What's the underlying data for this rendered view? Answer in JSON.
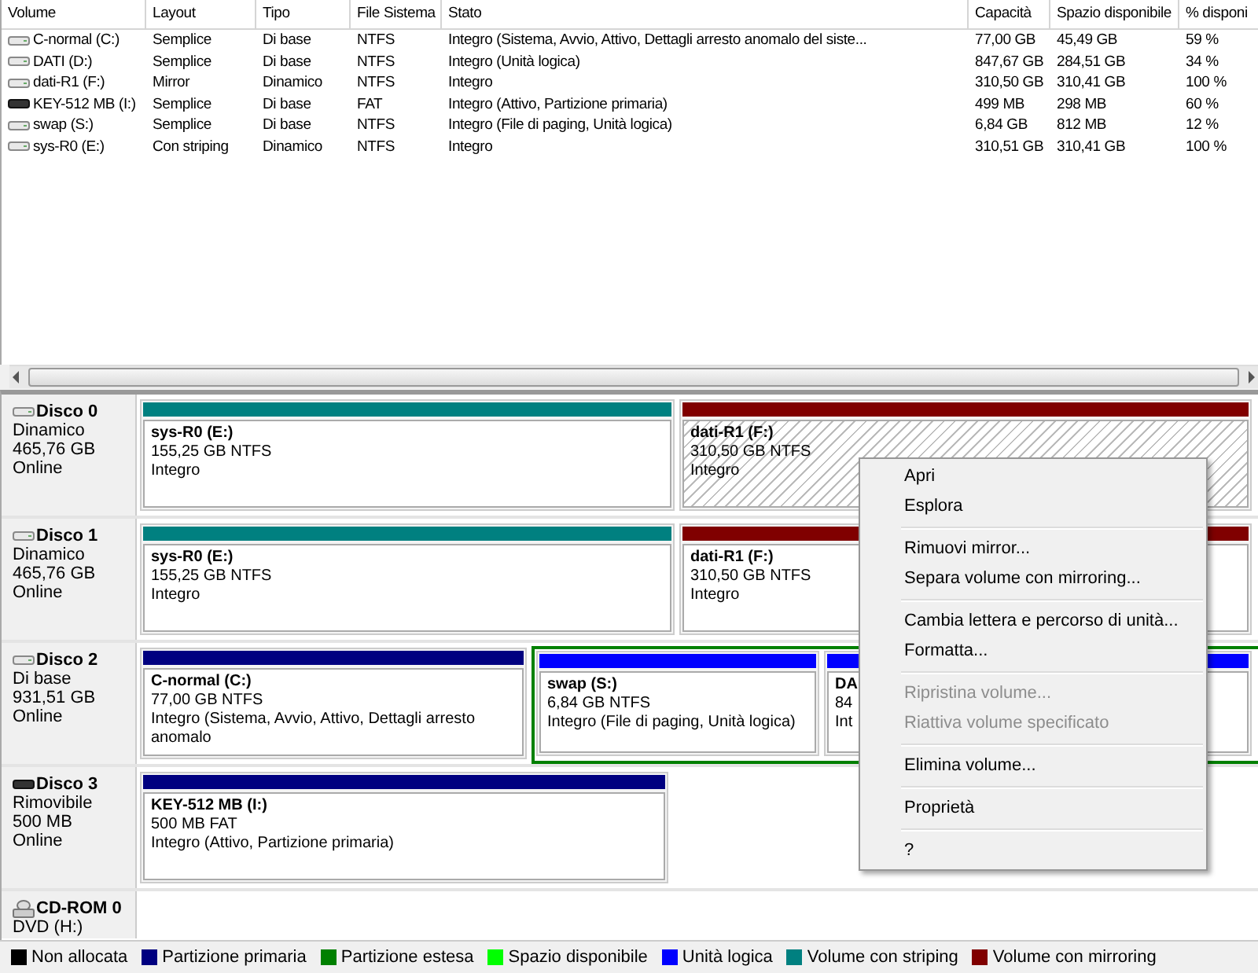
{
  "table": {
    "columns": [
      "Volume",
      "Layout",
      "Tipo",
      "File Sistema",
      "Stato",
      "Capacità",
      "Spazio disponibile",
      "% disponi"
    ],
    "rows": [
      {
        "kind": "disk",
        "cells": [
          "C-normal (C:)",
          "Semplice",
          "Di base",
          "NTFS",
          "Integro (Sistema, Avvio, Attivo, Dettagli arresto anomalo del siste...",
          "77,00 GB",
          "45,49 GB",
          "59 %"
        ]
      },
      {
        "kind": "disk",
        "cells": [
          "DATI (D:)",
          "Semplice",
          "Di base",
          "NTFS",
          "Integro (Unità logica)",
          "847,67 GB",
          "284,51 GB",
          "34 %"
        ]
      },
      {
        "kind": "disk",
        "cells": [
          "dati-R1 (F:)",
          "Mirror",
          "Dinamico",
          "NTFS",
          "Integro",
          "310,50 GB",
          "310,41 GB",
          "100 %"
        ]
      },
      {
        "kind": "removable",
        "cells": [
          "KEY-512 MB (I:)",
          "Semplice",
          "Di base",
          "FAT",
          "Integro (Attivo, Partizione primaria)",
          "499 MB",
          "298 MB",
          "60 %"
        ]
      },
      {
        "kind": "disk",
        "cells": [
          "swap (S:)",
          "Semplice",
          "Di base",
          "NTFS",
          "Integro (File di paging, Unità logica)",
          "6,84 GB",
          "812 MB",
          "12 %"
        ]
      },
      {
        "kind": "disk",
        "cells": [
          "sys-R0 (E:)",
          "Con striping",
          "Dinamico",
          "NTFS",
          "Integro",
          "310,51 GB",
          "310,41 GB",
          "100 %"
        ]
      }
    ]
  },
  "disks": [
    {
      "kind": "disk",
      "name": "Disco 0",
      "lines": [
        "Dinamico",
        "465,76 GB",
        "Online"
      ],
      "partitions": [
        {
          "kind": "striping",
          "selected": false,
          "name": "sys-R0  (E:)",
          "lines": [
            "155,25 GB NTFS",
            "Integro"
          ]
        },
        {
          "kind": "mirror",
          "selected": true,
          "name": "dati-R1  (F:)",
          "lines": [
            "310,50 GB NTFS",
            "Integro"
          ]
        }
      ]
    },
    {
      "kind": "disk",
      "name": "Disco 1",
      "lines": [
        "Dinamico",
        "465,76 GB",
        "Online"
      ],
      "partitions": [
        {
          "kind": "striping",
          "selected": false,
          "name": "sys-R0  (E:)",
          "lines": [
            "155,25 GB NTFS",
            "Integro"
          ]
        },
        {
          "kind": "mirror",
          "selected": false,
          "name": "dati-R1  (F:)",
          "lines": [
            "310,50 GB NTFS",
            "Integro"
          ]
        }
      ]
    },
    {
      "kind": "disk",
      "name": "Disco 2",
      "lines": [
        "Di base",
        "931,51 GB",
        "Online"
      ],
      "partitions": [
        {
          "kind": "primary",
          "selected": false,
          "name": "C-normal  (C:)",
          "lines": [
            "77,00 GB NTFS",
            "Integro (Sistema, Avvio, Attivo, Dettagli arresto anomalo"
          ]
        },
        {
          "kind": "extended",
          "children": [
            {
              "kind": "logical",
              "selected": false,
              "name": "swap  (S:)",
              "lines": [
                "6,84 GB NTFS",
                "Integro (File di paging, Unità logica)"
              ]
            },
            {
              "kind": "logical",
              "selected": false,
              "name": "DA",
              "lines": [
                "84",
                "Int"
              ]
            }
          ]
        }
      ]
    },
    {
      "kind": "removable",
      "name": "Disco 3",
      "lines": [
        "Rimovibile",
        "500 MB",
        "Online"
      ],
      "partitions": [
        {
          "kind": "primary",
          "selected": false,
          "name": "KEY-512 MB  (I:)",
          "lines": [
            "500 MB FAT",
            "Integro (Attivo, Partizione primaria)"
          ]
        }
      ]
    },
    {
      "kind": "cdrom",
      "name": "CD-ROM 0",
      "lines": [
        "DVD (H:)"
      ]
    }
  ],
  "context_menu": {
    "groups": [
      [
        {
          "label": "Apri",
          "disabled": false
        },
        {
          "label": "Esplora",
          "disabled": false
        }
      ],
      [
        {
          "label": "Rimuovi mirror...",
          "disabled": false
        },
        {
          "label": "Separa volume con mirroring...",
          "disabled": false
        }
      ],
      [
        {
          "label": "Cambia lettera e percorso di unità...",
          "disabled": false
        },
        {
          "label": "Formatta...",
          "disabled": false
        }
      ],
      [
        {
          "label": "Ripristina volume...",
          "disabled": true
        },
        {
          "label": "Riattiva volume specificato",
          "disabled": true
        }
      ],
      [
        {
          "label": "Elimina volume...",
          "disabled": false
        }
      ],
      [
        {
          "label": "Proprietà",
          "disabled": false
        }
      ],
      [
        {
          "label": "?",
          "disabled": false
        }
      ]
    ]
  },
  "legend": [
    {
      "label": "Non allocata",
      "color": "#000000"
    },
    {
      "label": "Partizione primaria",
      "color": "#000080"
    },
    {
      "label": "Partizione estesa",
      "color": "#008000"
    },
    {
      "label": "Spazio disponibile",
      "color": "#00ff00"
    },
    {
      "label": "Unità logica",
      "color": "#0000ff"
    },
    {
      "label": "Volume con striping",
      "color": "#008080"
    },
    {
      "label": "Volume con mirroring",
      "color": "#800000"
    }
  ]
}
